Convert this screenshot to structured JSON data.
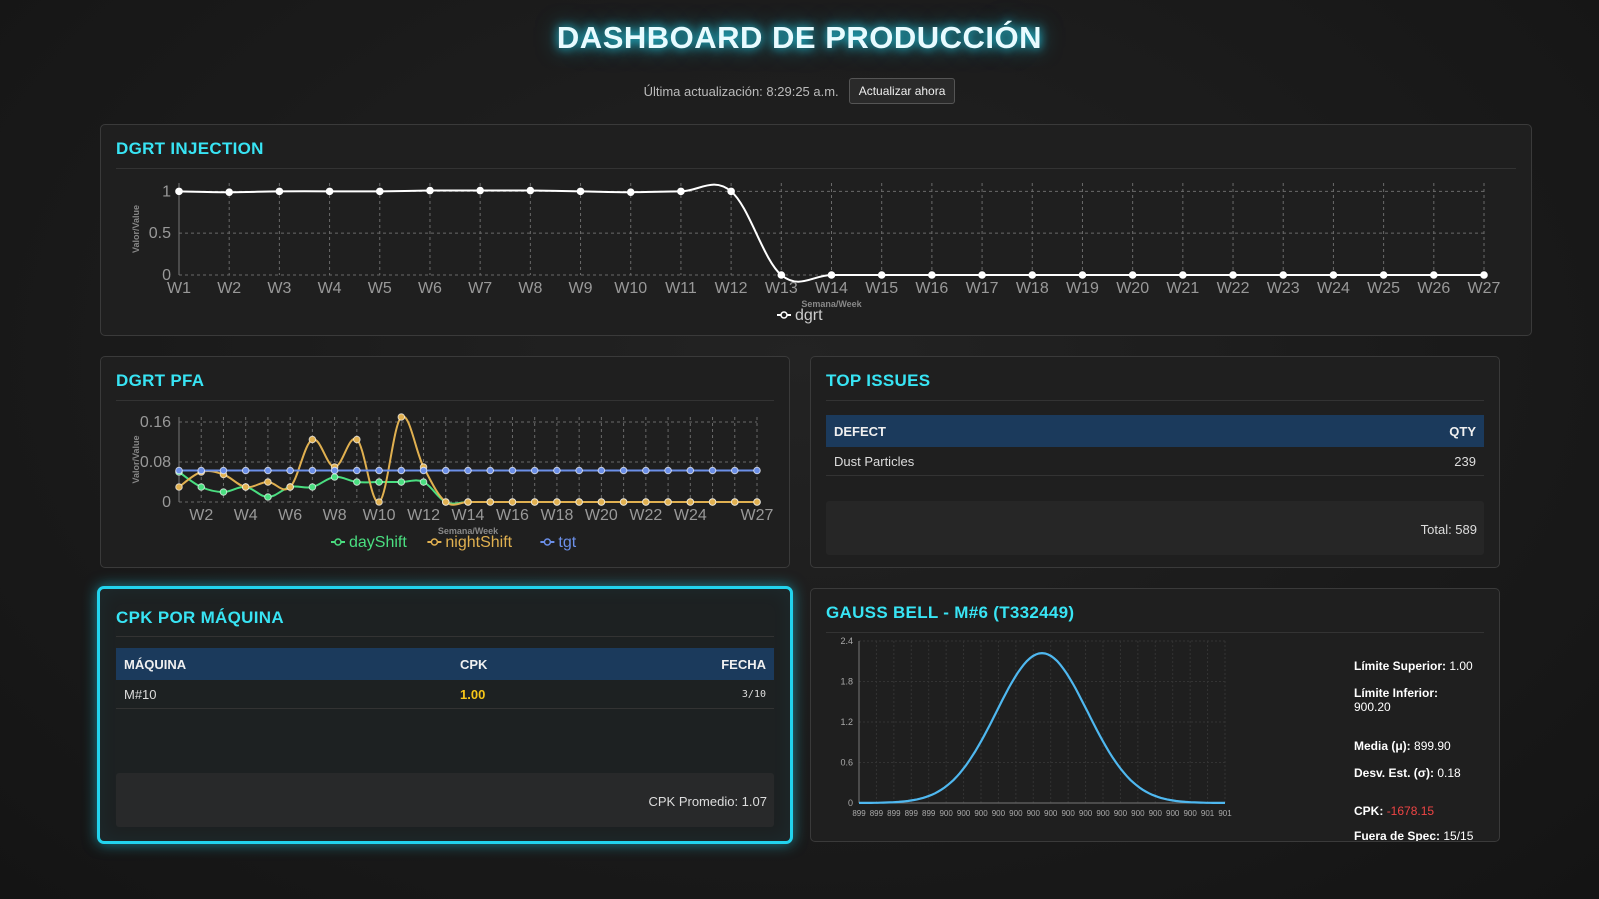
{
  "header": {
    "title": "DASHBOARD DE PRODUCCIÓN",
    "last_update_label": "Última actualización: 8:29:25 a.m.",
    "refresh_button": "Actualizar ahora"
  },
  "injection": {
    "title": "DGRT INJECTION",
    "chart_data": {
      "type": "line",
      "title": "",
      "xlabel": "Semana/Week",
      "ylabel": "Valor/Value",
      "categories": [
        "W1",
        "W2",
        "W3",
        "W4",
        "W5",
        "W6",
        "W7",
        "W8",
        "W9",
        "W10",
        "W11",
        "W12",
        "W13",
        "W14",
        "W15",
        "W16",
        "W17",
        "W18",
        "W19",
        "W20",
        "W21",
        "W22",
        "W23",
        "W24",
        "W25",
        "W26",
        "W27"
      ],
      "y_ticks": [
        "0",
        "0.5",
        "1"
      ],
      "ylim": [
        0,
        1.1
      ],
      "grid": true,
      "legend": "bottom",
      "series": [
        {
          "name": "dgrt",
          "color": "#ffffff",
          "values": [
            1.0,
            0.99,
            1.0,
            1.0,
            1.0,
            1.01,
            1.01,
            1.01,
            1.0,
            0.99,
            1.0,
            1.0,
            0,
            0,
            0,
            0,
            0,
            0,
            0,
            0,
            0,
            0,
            0,
            0,
            0,
            0,
            0
          ]
        }
      ]
    }
  },
  "pfa": {
    "title": "DGRT PFA",
    "chart_data": {
      "type": "line",
      "title": "",
      "xlabel": "Semana/Week",
      "ylabel": "Valor/Value",
      "categories": [
        "W1",
        "W2",
        "W3",
        "W4",
        "W5",
        "W6",
        "W7",
        "W8",
        "W9",
        "W10",
        "W11",
        "W12",
        "W13",
        "W14",
        "W15",
        "W16",
        "W17",
        "W18",
        "W19",
        "W20",
        "W21",
        "W22",
        "W23",
        "W24",
        "W25",
        "W26",
        "W27"
      ],
      "x_tick_labels": [
        "W2",
        "W4",
        "W6",
        "W8",
        "W10",
        "W12",
        "W14",
        "W16",
        "W18",
        "W20",
        "W22",
        "W24",
        "W27"
      ],
      "y_ticks": [
        "0",
        "0.08",
        "0.16"
      ],
      "ylim": [
        0,
        0.17
      ],
      "grid": true,
      "legend": "bottom",
      "series": [
        {
          "name": "dayShift",
          "color": "#4ade80",
          "values": [
            0.06,
            0.03,
            0.02,
            0.03,
            0.01,
            0.03,
            0.03,
            0.05,
            0.04,
            0.04,
            0.04,
            0.04,
            0,
            0,
            0,
            0,
            0,
            0,
            0,
            0,
            0,
            0,
            0,
            0,
            0,
            0,
            0
          ]
        },
        {
          "name": "nightShift",
          "color": "#e0b050",
          "values": [
            0.03,
            0.06,
            0.055,
            0.03,
            0.04,
            0.03,
            0.125,
            0.07,
            0.125,
            0.0,
            0.17,
            0.07,
            0,
            0,
            0,
            0,
            0,
            0,
            0,
            0,
            0,
            0,
            0,
            0,
            0,
            0,
            0
          ]
        },
        {
          "name": "tgt",
          "color": "#6b8fe8",
          "values": [
            0.063,
            0.063,
            0.063,
            0.063,
            0.063,
            0.063,
            0.063,
            0.063,
            0.063,
            0.063,
            0.063,
            0.063,
            0.063,
            0.063,
            0.063,
            0.063,
            0.063,
            0.063,
            0.063,
            0.063,
            0.063,
            0.063,
            0.063,
            0.063,
            0.063,
            0.063,
            0.063
          ]
        }
      ]
    }
  },
  "top_issues": {
    "title": "TOP ISSUES",
    "columns": [
      "DEFECT",
      "QTY"
    ],
    "rows": [
      {
        "defect": "Dust Particles",
        "qty": "239"
      }
    ],
    "total": "Total: 589"
  },
  "cpk": {
    "title": "CPK POR MÁQUINA",
    "columns": [
      "MÁQUINA",
      "CPK",
      "FECHA"
    ],
    "rows": [
      {
        "machine": "M#10",
        "cpk": "1.00",
        "date": "3/10"
      }
    ],
    "average": "CPK Promedio: 1.07"
  },
  "gauss": {
    "title": "GAUSS BELL - M#6 (T332449)",
    "chart_data": {
      "type": "line",
      "title": "",
      "xlabel": "",
      "ylabel": "",
      "y_ticks": [
        "0",
        "0.6",
        "1.2",
        "1.8",
        "2.4"
      ],
      "ylim": [
        0,
        2.4
      ],
      "grid": true,
      "x_tick_labels": [
        "899",
        "899",
        "899",
        "899",
        "899",
        "900",
        "900",
        "900",
        "900",
        "900",
        "900",
        "900",
        "900",
        "900",
        "900",
        "900",
        "900",
        "900",
        "900",
        "900",
        "901",
        "901"
      ],
      "series": [
        {
          "name": "",
          "color": "#4fb8f0",
          "mean": 899.9,
          "std": 0.18,
          "peak": 2.22
        }
      ]
    },
    "stats": {
      "upper_label": "Límite Superior:",
      "upper_value": "1.00",
      "lower_label": "Límite Inferior:",
      "lower_value": "900.20",
      "mean_label": "Media (μ):",
      "mean_value": "899.90",
      "std_label": "Desv. Est. (σ):",
      "std_value": "0.18",
      "cpk_label": "CPK:",
      "cpk_value": "-1678.15",
      "out_label": "Fuera de Spec:",
      "out_value": "15/15"
    }
  }
}
